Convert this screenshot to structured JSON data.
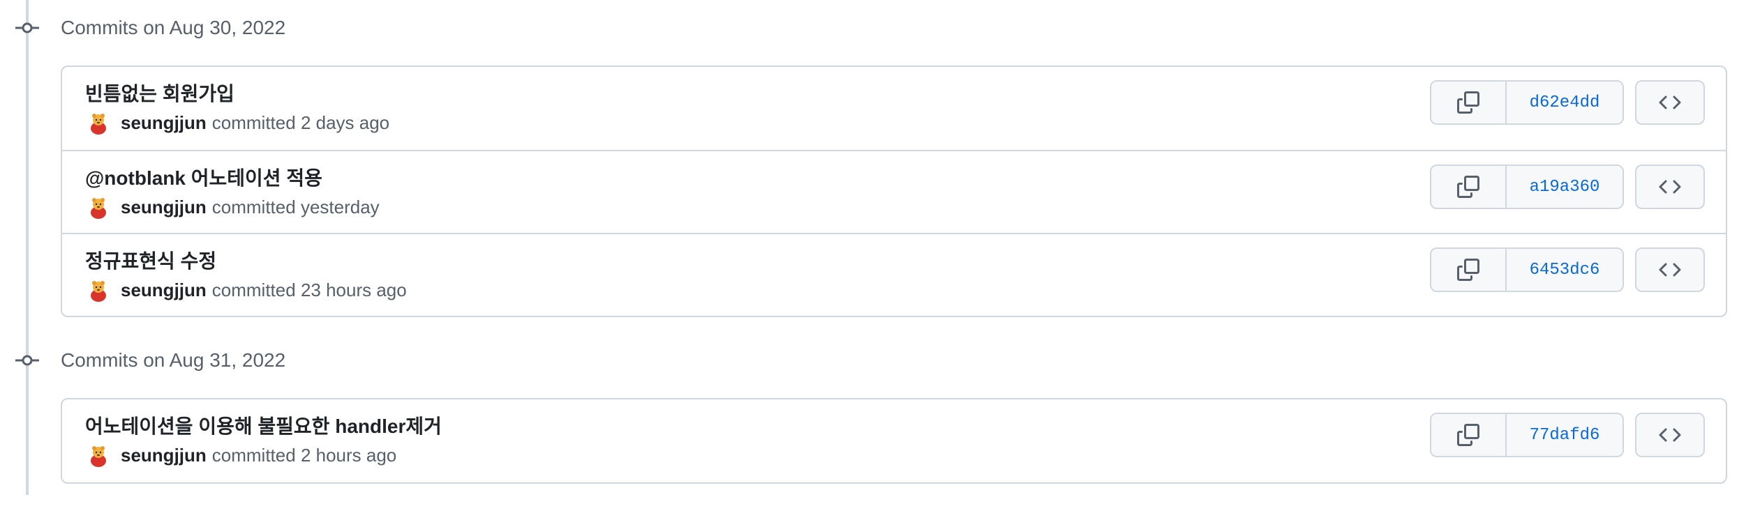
{
  "groups": [
    {
      "title": "Commits on Aug 30, 2022",
      "commits": [
        {
          "message": "빈틈없는 회원가입",
          "author": "seungjjun",
          "action": "committed",
          "time": "2 days ago",
          "sha": "d62e4dd"
        },
        {
          "message": "@notblank 어노테이션 적용",
          "author": "seungjjun",
          "action": "committed",
          "time": "yesterday",
          "sha": "a19a360"
        },
        {
          "message": "정규표현식 수정",
          "author": "seungjjun",
          "action": "committed",
          "time": "23 hours ago",
          "sha": "6453dc6"
        }
      ]
    },
    {
      "title": "Commits on Aug 31, 2022",
      "commits": [
        {
          "message": "어노테이션을 이용해 불필요한 handler제거",
          "author": "seungjjun",
          "action": "committed",
          "time": "2 hours ago",
          "sha": "77dafd6"
        }
      ]
    }
  ],
  "icons": {
    "commit_node": "git-commit-icon",
    "copy": "copy-icon",
    "browse": "code-icon",
    "avatar": "user-avatar"
  },
  "colors": {
    "link": "#0969da",
    "border": "#d0d7de",
    "muted": "#57606a",
    "text": "#1f2328",
    "button_bg": "#f6f8fa"
  }
}
